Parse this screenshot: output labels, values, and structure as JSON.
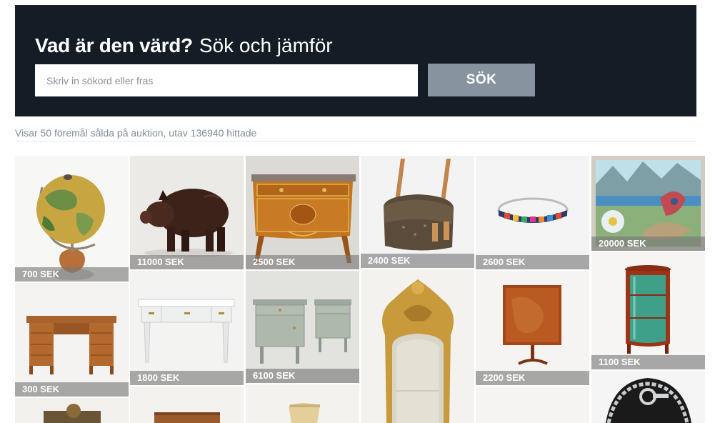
{
  "hero": {
    "title_bold": "Vad är den värd?",
    "title_light": "Sök och jämför",
    "search_placeholder": "Skriv in sökord eller fras",
    "search_button": "SÖK"
  },
  "results": {
    "summary": "Visar 50 föremål sålda på auktion, utav 136940 hittade"
  },
  "items": [
    {
      "price": "700 SEK",
      "icon": "globe"
    },
    {
      "price": "11000 SEK",
      "icon": "leather-pig"
    },
    {
      "price": "2500 SEK",
      "icon": "commode"
    },
    {
      "price": "2400 SEK",
      "icon": "handbag"
    },
    {
      "price": "2600 SEK",
      "icon": "enamel-bangle"
    },
    {
      "price": "20000 SEK",
      "icon": "painting"
    },
    {
      "price": "300 SEK",
      "icon": "writing-desk"
    },
    {
      "price": "1800 SEK",
      "icon": "white-desk"
    },
    {
      "price": "6100 SEK",
      "icon": "bedside-tables"
    },
    {
      "price": "",
      "icon": "gilt-mirror"
    },
    {
      "price": "2200 SEK",
      "icon": "tilt-table"
    },
    {
      "price": "1100 SEK",
      "icon": "vitrine-cabinet"
    },
    {
      "price": "",
      "icon": "silver-necklace"
    },
    {
      "price": "",
      "icon": "object"
    },
    {
      "price": "",
      "icon": "wooden-box"
    },
    {
      "price": "",
      "icon": "chair"
    },
    {
      "price": "",
      "icon": "object"
    }
  ]
}
